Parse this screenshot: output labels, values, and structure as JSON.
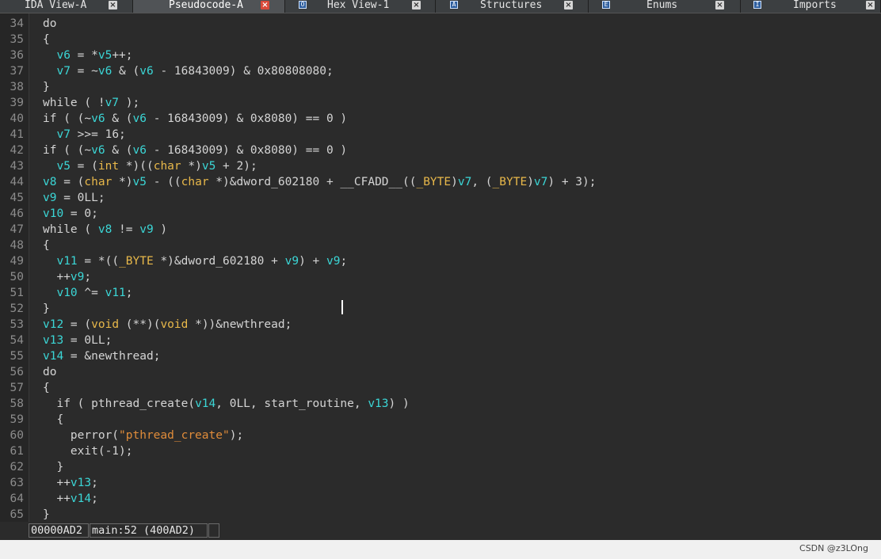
{
  "tabs": [
    {
      "label": "IDA View-A",
      "icon": "",
      "active": false
    },
    {
      "label": "Pseudocode-A",
      "icon": "",
      "active": true
    },
    {
      "label": "Hex View-1",
      "icon": "O",
      "active": false
    },
    {
      "label": "Structures",
      "icon": "A",
      "active": false
    },
    {
      "label": "Enums",
      "icon": "E",
      "active": false
    },
    {
      "label": "Imports",
      "icon": "I",
      "active": false
    }
  ],
  "tab_close_glyph": "×",
  "colors": {
    "background": "#2b2b2b",
    "variable": "#3bd6d6",
    "type": "#e8b84a",
    "string": "#e08c3a",
    "text": "#d4d4d4",
    "line_number": "#8c8c8c"
  },
  "code": [
    {
      "n": "34",
      "t": [
        [
          "do",
          "c"
        ]
      ]
    },
    {
      "n": "35",
      "t": [
        [
          "{",
          "c"
        ]
      ]
    },
    {
      "n": "36",
      "t": [
        [
          "  ",
          "c"
        ],
        [
          "v6",
          "v"
        ],
        [
          " = *",
          "c"
        ],
        [
          "v5",
          "v"
        ],
        [
          "++;",
          "c"
        ]
      ]
    },
    {
      "n": "37",
      "t": [
        [
          "  ",
          "c"
        ],
        [
          "v7",
          "v"
        ],
        [
          " = ~",
          "c"
        ],
        [
          "v6",
          "v"
        ],
        [
          " & (",
          "c"
        ],
        [
          "v6",
          "v"
        ],
        [
          " - 16843009) & 0x80808080;",
          "c"
        ]
      ]
    },
    {
      "n": "38",
      "t": [
        [
          "}",
          "c"
        ]
      ]
    },
    {
      "n": "39",
      "t": [
        [
          "while ( !",
          "c"
        ],
        [
          "v7",
          "v"
        ],
        [
          " );",
          "c"
        ]
      ]
    },
    {
      "n": "40",
      "t": [
        [
          "if ( (~",
          "c"
        ],
        [
          "v6",
          "v"
        ],
        [
          " & (",
          "c"
        ],
        [
          "v6",
          "v"
        ],
        [
          " - 16843009) & 0x8080) == 0 )",
          "c"
        ]
      ]
    },
    {
      "n": "41",
      "t": [
        [
          "  ",
          "c"
        ],
        [
          "v7",
          "v"
        ],
        [
          " >>= 16;",
          "c"
        ]
      ]
    },
    {
      "n": "42",
      "t": [
        [
          "if ( (~",
          "c"
        ],
        [
          "v6",
          "v"
        ],
        [
          " & (",
          "c"
        ],
        [
          "v6",
          "v"
        ],
        [
          " - 16843009) & 0x8080) == 0 )",
          "c"
        ]
      ]
    },
    {
      "n": "43",
      "t": [
        [
          "  ",
          "c"
        ],
        [
          "v5",
          "v"
        ],
        [
          " = (",
          "c"
        ],
        [
          "int",
          "t"
        ],
        [
          " *)((",
          "c"
        ],
        [
          "char",
          "t"
        ],
        [
          " *)",
          "c"
        ],
        [
          "v5",
          "v"
        ],
        [
          " + 2);",
          "c"
        ]
      ]
    },
    {
      "n": "44",
      "t": [
        [
          "v8",
          "v"
        ],
        [
          " = (",
          "c"
        ],
        [
          "char",
          "t"
        ],
        [
          " *)",
          "c"
        ],
        [
          "v5",
          "v"
        ],
        [
          " - ((",
          "c"
        ],
        [
          "char",
          "t"
        ],
        [
          " *)&dword_602180 + __CFADD__((",
          "c"
        ],
        [
          "_BYTE",
          "t"
        ],
        [
          ")",
          "c"
        ],
        [
          "v7",
          "v"
        ],
        [
          ", (",
          "c"
        ],
        [
          "_BYTE",
          "t"
        ],
        [
          ")",
          "c"
        ],
        [
          "v7",
          "v"
        ],
        [
          ") + 3);",
          "c"
        ]
      ]
    },
    {
      "n": "45",
      "t": [
        [
          "v9",
          "v"
        ],
        [
          " = 0LL;",
          "c"
        ]
      ]
    },
    {
      "n": "46",
      "t": [
        [
          "v10",
          "v"
        ],
        [
          " = 0;",
          "c"
        ]
      ]
    },
    {
      "n": "47",
      "t": [
        [
          "while ( ",
          "c"
        ],
        [
          "v8",
          "v"
        ],
        [
          " != ",
          "c"
        ],
        [
          "v9",
          "v"
        ],
        [
          " )",
          "c"
        ]
      ]
    },
    {
      "n": "48",
      "t": [
        [
          "{",
          "c"
        ]
      ]
    },
    {
      "n": "49",
      "t": [
        [
          "  ",
          "c"
        ],
        [
          "v11",
          "v"
        ],
        [
          " = *((",
          "c"
        ],
        [
          "_BYTE",
          "t"
        ],
        [
          " *)&dword_602180 + ",
          "c"
        ],
        [
          "v9",
          "v"
        ],
        [
          ") + ",
          "c"
        ],
        [
          "v9",
          "v"
        ],
        [
          ";",
          "c"
        ]
      ]
    },
    {
      "n": "50",
      "t": [
        [
          "  ++",
          "c"
        ],
        [
          "v9",
          "v"
        ],
        [
          ";",
          "c"
        ]
      ]
    },
    {
      "n": "51",
      "t": [
        [
          "  ",
          "c"
        ],
        [
          "v10",
          "v"
        ],
        [
          " ^= ",
          "c"
        ],
        [
          "v11",
          "v"
        ],
        [
          ";",
          "c"
        ]
      ]
    },
    {
      "n": "52",
      "t": [
        [
          "}",
          "c"
        ]
      ]
    },
    {
      "n": "53",
      "t": [
        [
          "v12",
          "v"
        ],
        [
          " = (",
          "c"
        ],
        [
          "void",
          "t"
        ],
        [
          " (**)(",
          "c"
        ],
        [
          "void",
          "t"
        ],
        [
          " *))&newthread;",
          "c"
        ]
      ]
    },
    {
      "n": "54",
      "t": [
        [
          "v13",
          "v"
        ],
        [
          " = 0LL;",
          "c"
        ]
      ]
    },
    {
      "n": "55",
      "t": [
        [
          "v14",
          "v"
        ],
        [
          " = &newthread;",
          "c"
        ]
      ]
    },
    {
      "n": "56",
      "t": [
        [
          "do",
          "c"
        ]
      ]
    },
    {
      "n": "57",
      "t": [
        [
          "{",
          "c"
        ]
      ]
    },
    {
      "n": "58",
      "t": [
        [
          "  if ( pthread_create(",
          "c"
        ],
        [
          "v14",
          "v"
        ],
        [
          ", 0LL, start_routine, ",
          "c"
        ],
        [
          "v13",
          "v"
        ],
        [
          ") )",
          "c"
        ]
      ]
    },
    {
      "n": "59",
      "t": [
        [
          "  {",
          "c"
        ]
      ]
    },
    {
      "n": "60",
      "t": [
        [
          "    perror(",
          "c"
        ],
        [
          "\"pthread_create\"",
          "s"
        ],
        [
          ");",
          "c"
        ]
      ]
    },
    {
      "n": "61",
      "t": [
        [
          "    exit(-1);",
          "c"
        ]
      ]
    },
    {
      "n": "62",
      "t": [
        [
          "  }",
          "c"
        ]
      ]
    },
    {
      "n": "63",
      "t": [
        [
          "  ++",
          "c"
        ],
        [
          "v13",
          "v"
        ],
        [
          ";",
          "c"
        ]
      ]
    },
    {
      "n": "64",
      "t": [
        [
          "  ++",
          "c"
        ],
        [
          "v14",
          "v"
        ],
        [
          ";",
          "c"
        ]
      ]
    },
    {
      "n": "65",
      "t": [
        [
          "}",
          "c"
        ]
      ]
    }
  ],
  "status": {
    "address": "00000AD2",
    "location": "main:52 (400AD2)",
    "extra": ""
  },
  "watermark": "CSDN @z3LOng"
}
